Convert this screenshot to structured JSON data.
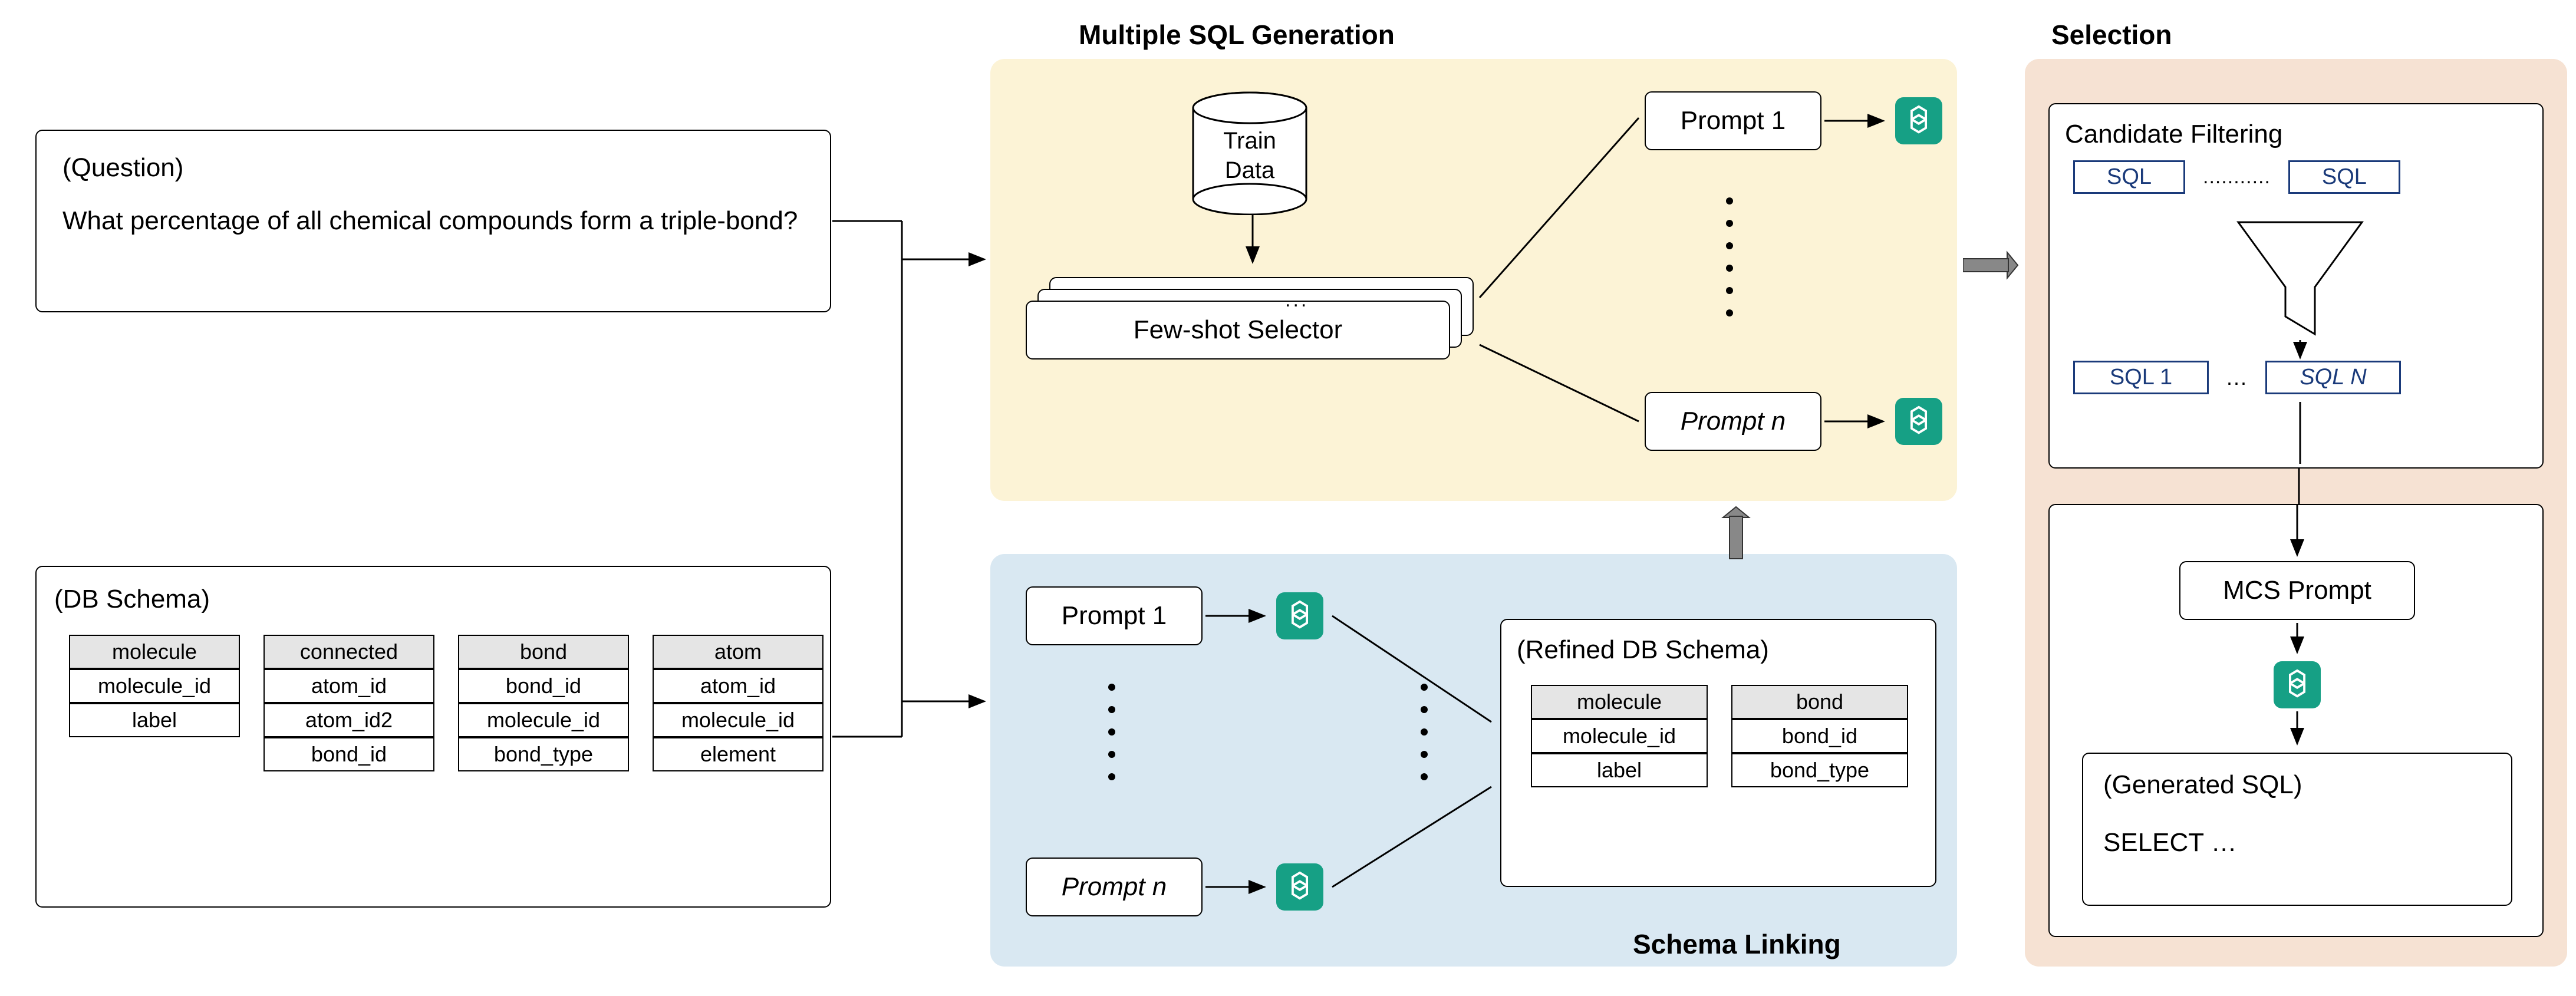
{
  "input": {
    "question_label": "(Question)",
    "question_text": "What percentage of all chemical compounds form a triple-bond?",
    "schema_label": "(DB Schema)",
    "tables": {
      "molecule": {
        "head": "molecule",
        "cols": [
          "molecule_id",
          "label"
        ]
      },
      "connected": {
        "head": "connected",
        "cols": [
          "atom_id",
          "atom_id2",
          "bond_id"
        ]
      },
      "bond": {
        "head": "bond",
        "cols": [
          "bond_id",
          "molecule_id",
          "bond_type"
        ]
      },
      "atom": {
        "head": "atom",
        "cols": [
          "atom_id",
          "molecule_id",
          "element"
        ]
      }
    }
  },
  "generation": {
    "title": "Multiple SQL Generation",
    "train_data_top": "Train",
    "train_data_bottom": "Data",
    "few_shot": "Few-shot Selector",
    "prompt1": "Prompt 1",
    "promptn": "Prompt n"
  },
  "schema_linking": {
    "title": "Schema Linking",
    "prompt1": "Prompt 1",
    "promptn": "Prompt n",
    "refined_label": "(Refined DB Schema)",
    "tables": {
      "molecule": {
        "head": "molecule",
        "cols": [
          "molecule_id",
          "label"
        ]
      },
      "bond": {
        "head": "bond",
        "cols": [
          "bond_id",
          "bond_type"
        ]
      }
    }
  },
  "selection": {
    "title": "Selection",
    "filtering_label": "Candidate Filtering",
    "sql_generic": "SQL",
    "sql1": "SQL 1",
    "sqlN": "SQL N",
    "dots": "...",
    "dots2": "...........",
    "mcs_label": "MCS Prompt",
    "gen_label": "(Generated SQL)",
    "gen_text": "SELECT …"
  }
}
